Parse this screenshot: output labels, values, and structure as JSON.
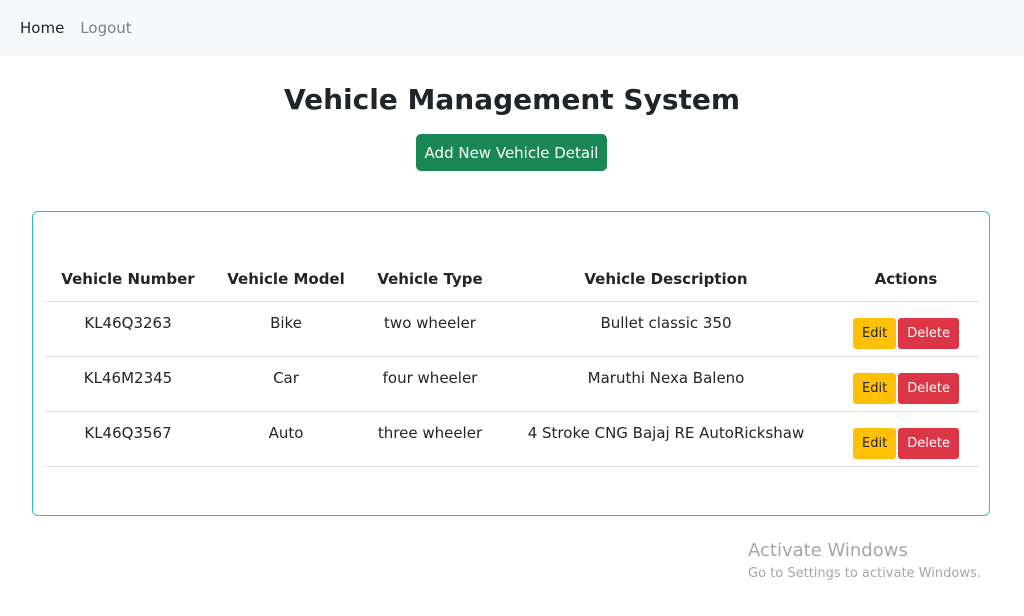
{
  "nav": {
    "home": "Home",
    "logout": "Logout"
  },
  "page": {
    "title": "Vehicle Management System",
    "add_button": "Add New Vehicle Detail"
  },
  "table": {
    "headers": [
      "Vehicle Number",
      "Vehicle Model",
      "Vehicle Type",
      "Vehicle Description",
      "Actions"
    ],
    "rows": [
      {
        "number": "KL46Q3263",
        "model": "Bike",
        "type": "two wheeler",
        "description": "Bullet classic 350"
      },
      {
        "number": "KL46M2345",
        "model": "Car",
        "type": "four wheeler",
        "description": "Maruthi Nexa Baleno"
      },
      {
        "number": "KL46Q3567",
        "model": "Auto",
        "type": "three wheeler",
        "description": "4 Stroke CNG Bajaj RE AutoRickshaw"
      }
    ],
    "edit_label": "Edit",
    "delete_label": "Delete"
  },
  "watermark": {
    "title": "Activate Windows",
    "subtitle": "Go to Settings to activate Windows."
  },
  "colors": {
    "primary_success": "#198754",
    "warning": "#ffc107",
    "danger": "#dc3545",
    "card_border": "#20c4c9"
  }
}
